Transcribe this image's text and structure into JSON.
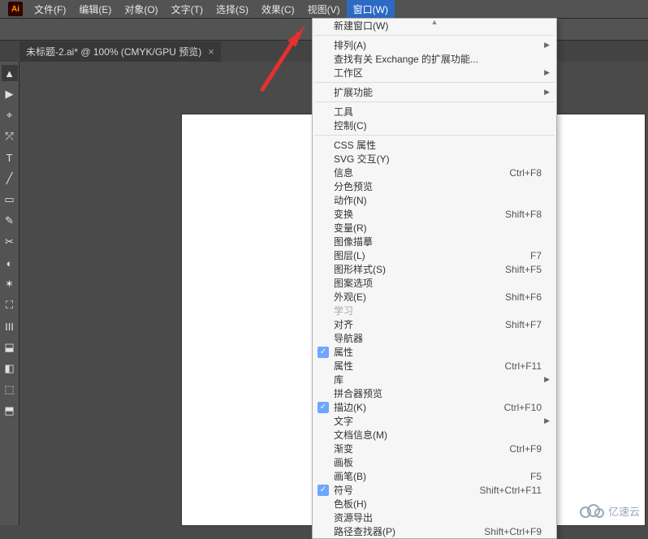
{
  "logo": "Ai",
  "menubar": {
    "items": [
      "文件(F)",
      "编辑(E)",
      "对象(O)",
      "文字(T)",
      "选择(S)",
      "效果(C)",
      "视图(V)",
      "窗口(W)"
    ]
  },
  "tab": {
    "title": "未标题-2.ai* @ 100% (CMYK/GPU 预览)",
    "close": "×"
  },
  "tools": [
    "▲",
    "▶",
    "⌖",
    "⤱",
    "T",
    "╱",
    "▭",
    "✎",
    "✂",
    "◐",
    "✶",
    "⛶",
    "III",
    "⬓",
    "◧",
    "⬚",
    "⬒"
  ],
  "dropdown": {
    "sections": [
      [
        {
          "label": "新建窗口(W)"
        }
      ],
      [
        {
          "label": "排列(A)",
          "sub": true
        },
        {
          "label": "查找有关 Exchange 的扩展功能..."
        },
        {
          "label": "工作区",
          "sub": true
        }
      ],
      [
        {
          "label": "扩展功能",
          "sub": true
        }
      ],
      [
        {
          "label": "工具"
        },
        {
          "label": "控制(C)"
        }
      ],
      [
        {
          "label": "CSS 属性"
        },
        {
          "label": "SVG 交互(Y)"
        },
        {
          "label": "信息",
          "short": "Ctrl+F8"
        },
        {
          "label": "分色预览"
        },
        {
          "label": "动作(N)"
        },
        {
          "label": "变换",
          "short": "Shift+F8"
        },
        {
          "label": "变量(R)"
        },
        {
          "label": "图像描摹"
        },
        {
          "label": "图层(L)",
          "short": "F7"
        },
        {
          "label": "图形样式(S)",
          "short": "Shift+F5"
        },
        {
          "label": "图案选项"
        },
        {
          "label": "外观(E)",
          "short": "Shift+F6"
        },
        {
          "label": "学习",
          "disabled": true
        },
        {
          "label": "对齐",
          "short": "Shift+F7"
        },
        {
          "label": "导航器"
        },
        {
          "label": "属性",
          "checked": true
        },
        {
          "label": "属性",
          "short": "Ctrl+F11"
        },
        {
          "label": "库",
          "sub": true
        },
        {
          "label": "拼合器预览"
        },
        {
          "label": "描边(K)",
          "short": "Ctrl+F10",
          "checked": true
        },
        {
          "label": "文字",
          "sub": true
        },
        {
          "label": "文档信息(M)"
        },
        {
          "label": "渐变",
          "short": "Ctrl+F9"
        },
        {
          "label": "画板"
        },
        {
          "label": "画笔(B)",
          "short": "F5"
        },
        {
          "label": "符号",
          "short": "Shift+Ctrl+F11",
          "checked": true
        },
        {
          "label": "色板(H)"
        },
        {
          "label": "资源导出"
        },
        {
          "label": "路径查找器(P)",
          "short": "Shift+Ctrl+F9"
        }
      ]
    ]
  },
  "watermark": "亿速云"
}
